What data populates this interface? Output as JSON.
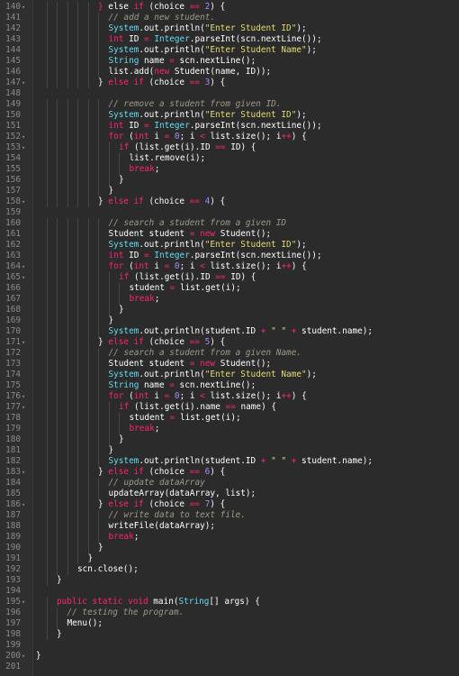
{
  "editor": {
    "colors": {
      "background": "#2b2b2b",
      "gutter": "#2f2f2f",
      "line_number": "#8a8a8a",
      "keyword": "#f92672",
      "string": "#e6db74",
      "number": "#ae81ff",
      "class": "#66d9ef",
      "comment": "#9e9a87",
      "plain": "#ffffff"
    },
    "lines": [
      {
        "n": "140",
        "fold": true,
        "indent": 6,
        "t": [
          [
            "kw",
            "}"
          ],
          [
            "plain",
            " else "
          ],
          [
            "kw",
            "if"
          ],
          [
            "plain",
            " (choice "
          ],
          [
            "kw",
            "=="
          ],
          [
            "plain",
            " "
          ],
          [
            "num",
            "2"
          ],
          [
            "plain",
            ") {"
          ]
        ]
      },
      {
        "n": "141",
        "indent": 7,
        "t": [
          [
            "com",
            "// add a new student."
          ]
        ]
      },
      {
        "n": "142",
        "indent": 7,
        "t": [
          [
            "cls",
            "System"
          ],
          [
            "plain",
            ".out.println("
          ],
          [
            "str",
            "\"Enter Student ID\""
          ],
          [
            "plain",
            ");"
          ]
        ]
      },
      {
        "n": "143",
        "indent": 7,
        "t": [
          [
            "kw",
            "int"
          ],
          [
            "plain",
            " ID "
          ],
          [
            "kw",
            "="
          ],
          [
            "plain",
            " "
          ],
          [
            "cls",
            "Integer"
          ],
          [
            "plain",
            ".parseInt(scn.nextLine());"
          ]
        ]
      },
      {
        "n": "144",
        "indent": 7,
        "t": [
          [
            "cls",
            "System"
          ],
          [
            "plain",
            ".out.println("
          ],
          [
            "str",
            "\"Enter Student Name\""
          ],
          [
            "plain",
            ");"
          ]
        ]
      },
      {
        "n": "145",
        "indent": 7,
        "t": [
          [
            "cls",
            "String"
          ],
          [
            "plain",
            " name "
          ],
          [
            "kw",
            "="
          ],
          [
            "plain",
            " scn.nextLine();"
          ]
        ]
      },
      {
        "n": "146",
        "indent": 7,
        "t": [
          [
            "plain",
            "list.add("
          ],
          [
            "kw",
            "new"
          ],
          [
            "plain",
            " Student(name, ID));"
          ]
        ]
      },
      {
        "n": "147",
        "fold": true,
        "indent": 6,
        "t": [
          [
            "plain",
            "} "
          ],
          [
            "kw",
            "else if"
          ],
          [
            "plain",
            " (choice "
          ],
          [
            "kw",
            "=="
          ],
          [
            "plain",
            " "
          ],
          [
            "num",
            "3"
          ],
          [
            "plain",
            ") {"
          ]
        ]
      },
      {
        "n": "148",
        "indent": 0,
        "t": []
      },
      {
        "n": "149",
        "indent": 7,
        "t": [
          [
            "com",
            "// remove a student from given ID."
          ]
        ]
      },
      {
        "n": "150",
        "indent": 7,
        "t": [
          [
            "cls",
            "System"
          ],
          [
            "plain",
            ".out.println("
          ],
          [
            "str",
            "\"Enter Student ID\""
          ],
          [
            "plain",
            ");"
          ]
        ]
      },
      {
        "n": "151",
        "indent": 7,
        "t": [
          [
            "kw",
            "int"
          ],
          [
            "plain",
            " ID "
          ],
          [
            "kw",
            "="
          ],
          [
            "plain",
            " "
          ],
          [
            "cls",
            "Integer"
          ],
          [
            "plain",
            ".parseInt(scn.nextLine());"
          ]
        ]
      },
      {
        "n": "152",
        "fold": true,
        "indent": 7,
        "t": [
          [
            "kw",
            "for"
          ],
          [
            "plain",
            " ("
          ],
          [
            "kw",
            "int"
          ],
          [
            "plain",
            " i "
          ],
          [
            "kw",
            "="
          ],
          [
            "plain",
            " "
          ],
          [
            "num",
            "0"
          ],
          [
            "plain",
            "; i "
          ],
          [
            "kw",
            "<"
          ],
          [
            "plain",
            " list.size(); i"
          ],
          [
            "kw",
            "++"
          ],
          [
            "plain",
            ") {"
          ]
        ]
      },
      {
        "n": "153",
        "fold": true,
        "indent": 8,
        "t": [
          [
            "kw",
            "if"
          ],
          [
            "plain",
            " (list.get(i).ID "
          ],
          [
            "kw",
            "=="
          ],
          [
            "plain",
            " ID) {"
          ]
        ]
      },
      {
        "n": "154",
        "indent": 9,
        "t": [
          [
            "plain",
            "list.remove(i);"
          ]
        ]
      },
      {
        "n": "155",
        "indent": 9,
        "t": [
          [
            "kw",
            "break"
          ],
          [
            "plain",
            ";"
          ]
        ]
      },
      {
        "n": "156",
        "indent": 8,
        "t": [
          [
            "plain",
            "}"
          ]
        ]
      },
      {
        "n": "157",
        "indent": 7,
        "t": [
          [
            "plain",
            "}"
          ]
        ]
      },
      {
        "n": "158",
        "fold": true,
        "indent": 6,
        "t": [
          [
            "plain",
            "} "
          ],
          [
            "kw",
            "else if"
          ],
          [
            "plain",
            " (choice "
          ],
          [
            "kw",
            "=="
          ],
          [
            "plain",
            " "
          ],
          [
            "num",
            "4"
          ],
          [
            "plain",
            ") {"
          ]
        ]
      },
      {
        "n": "159",
        "indent": 0,
        "t": []
      },
      {
        "n": "160",
        "indent": 7,
        "t": [
          [
            "com",
            "// search a student from a given ID"
          ]
        ]
      },
      {
        "n": "161",
        "indent": 7,
        "t": [
          [
            "plain",
            "Student student "
          ],
          [
            "kw",
            "="
          ],
          [
            "plain",
            " "
          ],
          [
            "kw",
            "new"
          ],
          [
            "plain",
            " Student();"
          ]
        ]
      },
      {
        "n": "162",
        "indent": 7,
        "t": [
          [
            "cls",
            "System"
          ],
          [
            "plain",
            ".out.println("
          ],
          [
            "str",
            "\"Enter Student ID\""
          ],
          [
            "plain",
            ");"
          ]
        ]
      },
      {
        "n": "163",
        "indent": 7,
        "t": [
          [
            "kw",
            "int"
          ],
          [
            "plain",
            " ID "
          ],
          [
            "kw",
            "="
          ],
          [
            "plain",
            " "
          ],
          [
            "cls",
            "Integer"
          ],
          [
            "plain",
            ".parseInt(scn.nextLine());"
          ]
        ]
      },
      {
        "n": "164",
        "fold": true,
        "indent": 7,
        "t": [
          [
            "kw",
            "for"
          ],
          [
            "plain",
            " ("
          ],
          [
            "kw",
            "int"
          ],
          [
            "plain",
            " i "
          ],
          [
            "kw",
            "="
          ],
          [
            "plain",
            " "
          ],
          [
            "num",
            "0"
          ],
          [
            "plain",
            "; i "
          ],
          [
            "kw",
            "<"
          ],
          [
            "plain",
            " list.size(); i"
          ],
          [
            "kw",
            "++"
          ],
          [
            "plain",
            ") {"
          ]
        ]
      },
      {
        "n": "165",
        "fold": true,
        "indent": 8,
        "t": [
          [
            "kw",
            "if"
          ],
          [
            "plain",
            " (list.get(i).ID "
          ],
          [
            "kw",
            "=="
          ],
          [
            "plain",
            " ID) {"
          ]
        ]
      },
      {
        "n": "166",
        "indent": 9,
        "t": [
          [
            "plain",
            "student "
          ],
          [
            "kw",
            "="
          ],
          [
            "plain",
            " list.get(i);"
          ]
        ]
      },
      {
        "n": "167",
        "indent": 9,
        "t": [
          [
            "kw",
            "break"
          ],
          [
            "plain",
            ";"
          ]
        ]
      },
      {
        "n": "168",
        "indent": 8,
        "t": [
          [
            "plain",
            "}"
          ]
        ]
      },
      {
        "n": "169",
        "indent": 7,
        "t": [
          [
            "plain",
            "}"
          ]
        ]
      },
      {
        "n": "170",
        "indent": 7,
        "t": [
          [
            "cls",
            "System"
          ],
          [
            "plain",
            ".out.println(student.ID "
          ],
          [
            "kw",
            "+"
          ],
          [
            "plain",
            " "
          ],
          [
            "str",
            "\" \""
          ],
          [
            "plain",
            " "
          ],
          [
            "kw",
            "+"
          ],
          [
            "plain",
            " student.name);"
          ]
        ]
      },
      {
        "n": "171",
        "fold": true,
        "indent": 6,
        "t": [
          [
            "plain",
            "} "
          ],
          [
            "kw",
            "else if"
          ],
          [
            "plain",
            " (choice "
          ],
          [
            "kw",
            "=="
          ],
          [
            "plain",
            " "
          ],
          [
            "num",
            "5"
          ],
          [
            "plain",
            ") {"
          ]
        ]
      },
      {
        "n": "172",
        "indent": 7,
        "t": [
          [
            "com",
            "// search a student from a given Name."
          ]
        ]
      },
      {
        "n": "173",
        "indent": 7,
        "t": [
          [
            "plain",
            "Student student "
          ],
          [
            "kw",
            "="
          ],
          [
            "plain",
            " "
          ],
          [
            "kw",
            "new"
          ],
          [
            "plain",
            " Student();"
          ]
        ]
      },
      {
        "n": "174",
        "indent": 7,
        "t": [
          [
            "cls",
            "System"
          ],
          [
            "plain",
            ".out.println("
          ],
          [
            "str",
            "\"Enter Student Name\""
          ],
          [
            "plain",
            ");"
          ]
        ]
      },
      {
        "n": "175",
        "indent": 7,
        "t": [
          [
            "cls",
            "String"
          ],
          [
            "plain",
            " name "
          ],
          [
            "kw",
            "="
          ],
          [
            "plain",
            " scn.nextLine();"
          ]
        ]
      },
      {
        "n": "176",
        "fold": true,
        "indent": 7,
        "t": [
          [
            "kw",
            "for"
          ],
          [
            "plain",
            " ("
          ],
          [
            "kw",
            "int"
          ],
          [
            "plain",
            " i "
          ],
          [
            "kw",
            "="
          ],
          [
            "plain",
            " "
          ],
          [
            "num",
            "0"
          ],
          [
            "plain",
            "; i "
          ],
          [
            "kw",
            "<"
          ],
          [
            "plain",
            " list.size(); i"
          ],
          [
            "kw",
            "++"
          ],
          [
            "plain",
            ") {"
          ]
        ]
      },
      {
        "n": "177",
        "fold": true,
        "indent": 8,
        "t": [
          [
            "kw",
            "if"
          ],
          [
            "plain",
            " (list.get(i).name "
          ],
          [
            "kw",
            "=="
          ],
          [
            "plain",
            " name) {"
          ]
        ]
      },
      {
        "n": "178",
        "indent": 9,
        "t": [
          [
            "plain",
            "student "
          ],
          [
            "kw",
            "="
          ],
          [
            "plain",
            " list.get(i);"
          ]
        ]
      },
      {
        "n": "179",
        "indent": 9,
        "t": [
          [
            "kw",
            "break"
          ],
          [
            "plain",
            ";"
          ]
        ]
      },
      {
        "n": "180",
        "indent": 8,
        "t": [
          [
            "plain",
            "}"
          ]
        ]
      },
      {
        "n": "181",
        "indent": 7,
        "t": [
          [
            "plain",
            "}"
          ]
        ]
      },
      {
        "n": "182",
        "indent": 7,
        "t": [
          [
            "cls",
            "System"
          ],
          [
            "plain",
            ".out.println(student.ID "
          ],
          [
            "kw",
            "+"
          ],
          [
            "plain",
            " "
          ],
          [
            "str",
            "\" \""
          ],
          [
            "plain",
            " "
          ],
          [
            "kw",
            "+"
          ],
          [
            "plain",
            " student.name);"
          ]
        ]
      },
      {
        "n": "183",
        "fold": true,
        "indent": 6,
        "t": [
          [
            "plain",
            "} "
          ],
          [
            "kw",
            "else if"
          ],
          [
            "plain",
            " (choice "
          ],
          [
            "kw",
            "=="
          ],
          [
            "plain",
            " "
          ],
          [
            "num",
            "6"
          ],
          [
            "plain",
            ") {"
          ]
        ]
      },
      {
        "n": "184",
        "indent": 7,
        "t": [
          [
            "com",
            "// update dataArray"
          ]
        ]
      },
      {
        "n": "185",
        "indent": 7,
        "t": [
          [
            "plain",
            "updateArray(dataArray, list);"
          ]
        ]
      },
      {
        "n": "186",
        "fold": true,
        "indent": 6,
        "t": [
          [
            "plain",
            "} "
          ],
          [
            "kw",
            "else if"
          ],
          [
            "plain",
            " (choice "
          ],
          [
            "kw",
            "=="
          ],
          [
            "plain",
            " "
          ],
          [
            "num",
            "7"
          ],
          [
            "plain",
            ") {"
          ]
        ]
      },
      {
        "n": "187",
        "indent": 7,
        "t": [
          [
            "com",
            "// write data to text file."
          ]
        ]
      },
      {
        "n": "188",
        "indent": 7,
        "t": [
          [
            "plain",
            "writeFile(dataArray);"
          ]
        ]
      },
      {
        "n": "189",
        "indent": 7,
        "t": [
          [
            "kw",
            "break"
          ],
          [
            "plain",
            ";"
          ]
        ]
      },
      {
        "n": "190",
        "indent": 6,
        "t": [
          [
            "plain",
            "}"
          ]
        ]
      },
      {
        "n": "191",
        "indent": 5,
        "t": [
          [
            "plain",
            "}"
          ]
        ]
      },
      {
        "n": "192",
        "indent": 4,
        "t": [
          [
            "plain",
            "scn.close();"
          ]
        ]
      },
      {
        "n": "193",
        "indent": 2,
        "t": [
          [
            "plain",
            "}"
          ]
        ]
      },
      {
        "n": "194",
        "indent": 0,
        "t": []
      },
      {
        "n": "195",
        "fold": true,
        "indent": 2,
        "t": [
          [
            "kw",
            "public"
          ],
          [
            "plain",
            " "
          ],
          [
            "kw",
            "static"
          ],
          [
            "plain",
            " "
          ],
          [
            "kw",
            "void"
          ],
          [
            "plain",
            " main("
          ],
          [
            "cls",
            "String"
          ],
          [
            "plain",
            "[] args) {"
          ]
        ]
      },
      {
        "n": "196",
        "indent": 3,
        "t": [
          [
            "com",
            "// testing the program."
          ]
        ]
      },
      {
        "n": "197",
        "indent": 3,
        "t": [
          [
            "plain",
            "Menu();"
          ]
        ]
      },
      {
        "n": "198",
        "indent": 2,
        "t": [
          [
            "plain",
            "}"
          ]
        ]
      },
      {
        "n": "199",
        "indent": 0,
        "t": []
      },
      {
        "n": "200",
        "fold": true,
        "indent": 0,
        "t": [
          [
            "plain",
            "}"
          ]
        ]
      },
      {
        "n": "201",
        "indent": 0,
        "t": []
      }
    ]
  }
}
